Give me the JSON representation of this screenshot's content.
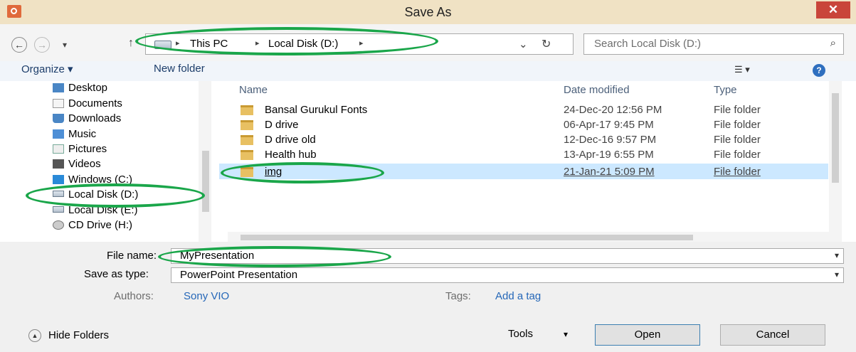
{
  "window": {
    "title": "Save As",
    "close_glyph": "✕"
  },
  "nav": {
    "back_glyph": "←",
    "forward_glyph": "→",
    "history_glyph": "▾",
    "up_glyph": "↑",
    "breadcrumb": [
      "This PC",
      "Local Disk (D:)"
    ],
    "sep_glyph": "▸",
    "addr_dropdown_glyph": "⌄",
    "refresh_glyph": "↻",
    "search_placeholder": "Search Local Disk (D:)",
    "search_glyph": "⌕"
  },
  "toolbar": {
    "organize": "Organize ▾",
    "new_folder": "New folder",
    "view_glyph": "☰ ▾",
    "help_glyph": "?"
  },
  "sidebar": {
    "items": [
      {
        "label": "Desktop",
        "icon": "desktop-icon"
      },
      {
        "label": "Documents",
        "icon": "documents-icon"
      },
      {
        "label": "Downloads",
        "icon": "downloads-icon"
      },
      {
        "label": "Music",
        "icon": "music-icon"
      },
      {
        "label": "Pictures",
        "icon": "pictures-icon"
      },
      {
        "label": "Videos",
        "icon": "videos-icon"
      },
      {
        "label": "Windows (C:)",
        "icon": "windows-drive-icon"
      },
      {
        "label": "Local Disk (D:)",
        "icon": "drive-icon",
        "selected": true
      },
      {
        "label": "Local Disk (E:)",
        "icon": "drive-icon"
      },
      {
        "label": "CD Drive (H:)",
        "icon": "cd-drive-icon"
      }
    ]
  },
  "files": {
    "columns": [
      "Name",
      "Date modified",
      "Type"
    ],
    "rows": [
      {
        "name": "Bansal Gurukul Fonts",
        "date": "24-Dec-20 12:56 PM",
        "type": "File folder"
      },
      {
        "name": "D drive",
        "date": "06-Apr-17 9:45 PM",
        "type": "File folder"
      },
      {
        "name": "D drive old",
        "date": "12-Dec-16 9:57 PM",
        "type": "File folder"
      },
      {
        "name": "Health hub",
        "date": "13-Apr-19 6:55 PM",
        "type": "File folder"
      },
      {
        "name": "img",
        "date": "21-Jan-21 5:09 PM",
        "type": "File folder",
        "selected": true
      }
    ]
  },
  "form": {
    "file_name_label": "File name:",
    "file_name_value": "MyPresentation",
    "save_type_label": "Save as type:",
    "save_type_value": "PowerPoint Presentation",
    "authors_label": "Authors:",
    "authors_value": "Sony VIO",
    "tags_label": "Tags:",
    "tags_value": "Add a tag"
  },
  "footer": {
    "hide_folders": "Hide Folders",
    "tools": "Tools",
    "tools_glyph": "▾",
    "open": "Open",
    "cancel": "Cancel"
  },
  "colors": {
    "annotation": "#1aa64a",
    "selection": "#cce8ff",
    "link": "#2567b8"
  }
}
